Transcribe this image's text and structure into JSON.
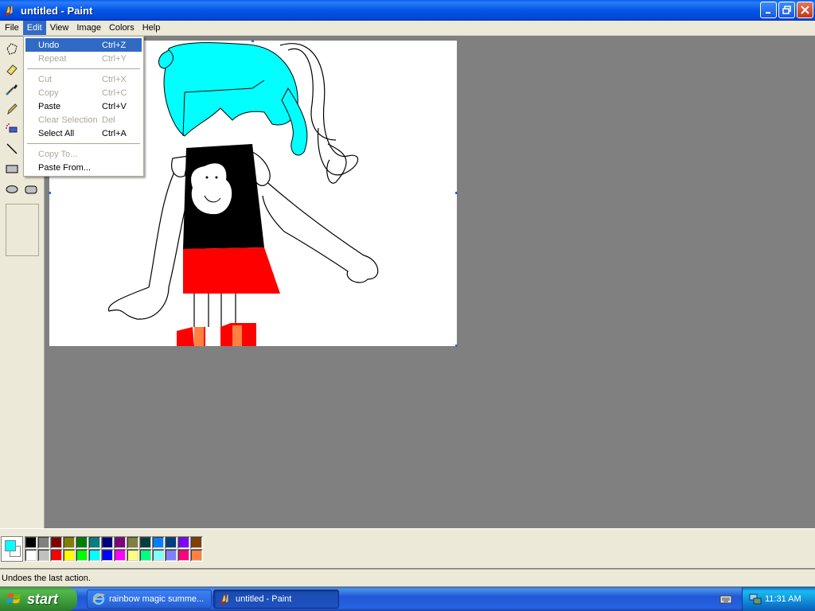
{
  "window": {
    "title": "untitled - Paint",
    "icon": "paint-app-icon"
  },
  "menubar": {
    "items": [
      "File",
      "Edit",
      "View",
      "Image",
      "Colors",
      "Help"
    ],
    "active": "Edit"
  },
  "edit_menu": {
    "items": [
      {
        "label": "Undo",
        "shortcut": "Ctrl+Z",
        "enabled": true,
        "highlighted": true
      },
      {
        "label": "Repeat",
        "shortcut": "Ctrl+Y",
        "enabled": false
      },
      {
        "separator": true
      },
      {
        "label": "Cut",
        "shortcut": "Ctrl+X",
        "enabled": false
      },
      {
        "label": "Copy",
        "shortcut": "Ctrl+C",
        "enabled": false
      },
      {
        "label": "Paste",
        "shortcut": "Ctrl+V",
        "enabled": true
      },
      {
        "label": "Clear Selection",
        "shortcut": "Del",
        "enabled": false
      },
      {
        "label": "Select All",
        "shortcut": "Ctrl+A",
        "enabled": true
      },
      {
        "separator": true
      },
      {
        "label": "Copy To...",
        "shortcut": "",
        "enabled": false
      },
      {
        "label": "Paste From...",
        "shortcut": "",
        "enabled": true
      }
    ]
  },
  "tools": [
    "free-form-select-icon",
    "eraser-icon",
    "color-picker-icon",
    "pencil-icon",
    "airbrush-icon",
    "line-icon",
    "rectangle-icon",
    "ellipse-icon",
    "rounded-rectangle-icon"
  ],
  "colors": {
    "foreground": "#00ffff",
    "background": "#ffffff",
    "palette_row1": [
      "#000000",
      "#808080",
      "#800000",
      "#808000",
      "#008000",
      "#008080",
      "#000080",
      "#800080",
      "#808040",
      "#004040",
      "#0080ff",
      "#004080",
      "#8000ff",
      "#804000"
    ],
    "palette_row2": [
      "#ffffff",
      "#c0c0c0",
      "#ff0000",
      "#ffff00",
      "#00ff00",
      "#00ffff",
      "#0000ff",
      "#ff00ff",
      "#ffff80",
      "#00ff80",
      "#80ffff",
      "#8080ff",
      "#ff0080",
      "#ff8040"
    ]
  },
  "status": {
    "text": "Undoes the last action."
  },
  "taskbar": {
    "start_label": "start",
    "buttons": [
      {
        "label": "rainbow magic summe...",
        "icon": "internet-explorer-icon",
        "active": false
      },
      {
        "label": "untitled - Paint",
        "icon": "paint-app-icon",
        "active": true
      }
    ],
    "clock": "11:31 AM"
  }
}
